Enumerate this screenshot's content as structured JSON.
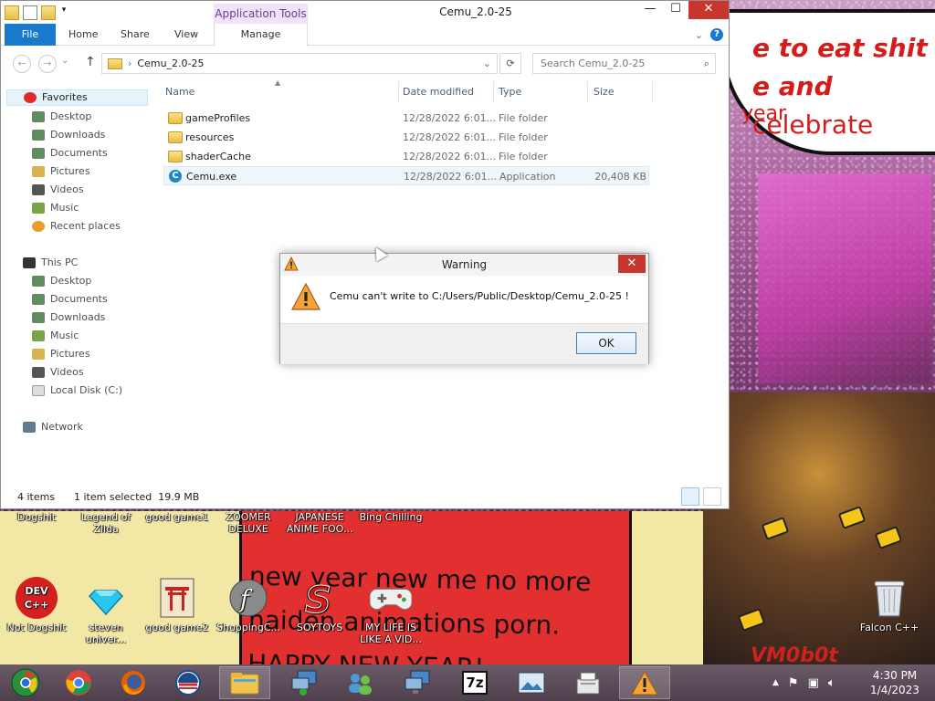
{
  "explorer": {
    "title": "Cemu_2.0-25",
    "context_tab": "Application Tools",
    "tabs": [
      {
        "label": "File"
      },
      {
        "label": "Home"
      },
      {
        "label": "Share"
      },
      {
        "label": "View"
      },
      {
        "label": "Manage"
      }
    ],
    "window_buttons": {
      "minimize": "—",
      "maximize": "☐",
      "close": "✕"
    },
    "address": {
      "path": "Cemu_2.0-25",
      "separator": "›"
    },
    "search_placeholder": "Search Cemu_2.0-25",
    "nav_pane": {
      "favorites_label": "Favorites",
      "favorites": [
        "Desktop",
        "Downloads",
        "Documents",
        "Pictures",
        "Videos",
        "Music",
        "Recent places"
      ],
      "thispc_label": "This PC",
      "thispc": [
        "Desktop",
        "Documents",
        "Downloads",
        "Music",
        "Pictures",
        "Videos",
        "Local Disk (C:)"
      ],
      "network_label": "Network"
    },
    "columns": {
      "name": "Name",
      "date": "Date modified",
      "type": "Type",
      "size": "Size"
    },
    "files": [
      {
        "name": "gameProfiles",
        "date": "12/28/2022 6:01...",
        "type": "File folder",
        "size": ""
      },
      {
        "name": "resources",
        "date": "12/28/2022 6:01...",
        "type": "File folder",
        "size": ""
      },
      {
        "name": "shaderCache",
        "date": "12/28/2022 6:01...",
        "type": "File folder",
        "size": ""
      },
      {
        "name": "Cemu.exe",
        "date": "12/28/2022 6:01...",
        "type": "Application",
        "size": "20,408 KB"
      }
    ],
    "status": {
      "count": "4 items",
      "selection": "1 item selected  19.9 MB"
    }
  },
  "dialog": {
    "title": "Warning",
    "message": "Cemu can't write to C:/Users/Public/Desktop/Cemu_2.0-25 !",
    "ok_label": "OK"
  },
  "wallpaper": {
    "bubble_line1": "e to eat shit",
    "bubble_line2a": "e and",
    "bubble_line2b": "celebrate",
    "bubble_line3": "year",
    "poster_line1": "new year new me no more",
    "poster_line2": "naiden animations porn.",
    "poster_line3": "HAPPY NEW YEAR!",
    "watermark": "VM0b0t"
  },
  "desktop_icons": [
    {
      "label": "Dogshit"
    },
    {
      "label": "Legend of Zilda"
    },
    {
      "label": "good game1"
    },
    {
      "label": "ZOOMER DELUXE"
    },
    {
      "label": "JAPANESE ANIME FOO..."
    },
    {
      "label": "Bing Chilling"
    },
    {
      "label": "Not Dogshit"
    },
    {
      "label": "steven univer..."
    },
    {
      "label": "good game2"
    },
    {
      "label": "ShoppingC..."
    },
    {
      "label": "SOYTOYS"
    },
    {
      "label": "MY LIFE IS LIKE A VID..."
    },
    {
      "label": "Falcon C++"
    }
  ],
  "icon_glyphs": {
    "devcpp": "DEV C++",
    "sevenzip": "7z"
  },
  "taskbar": {
    "clock_time": "4:30 PM",
    "clock_date": "1/4/2023",
    "tray_chevron": "▲"
  }
}
